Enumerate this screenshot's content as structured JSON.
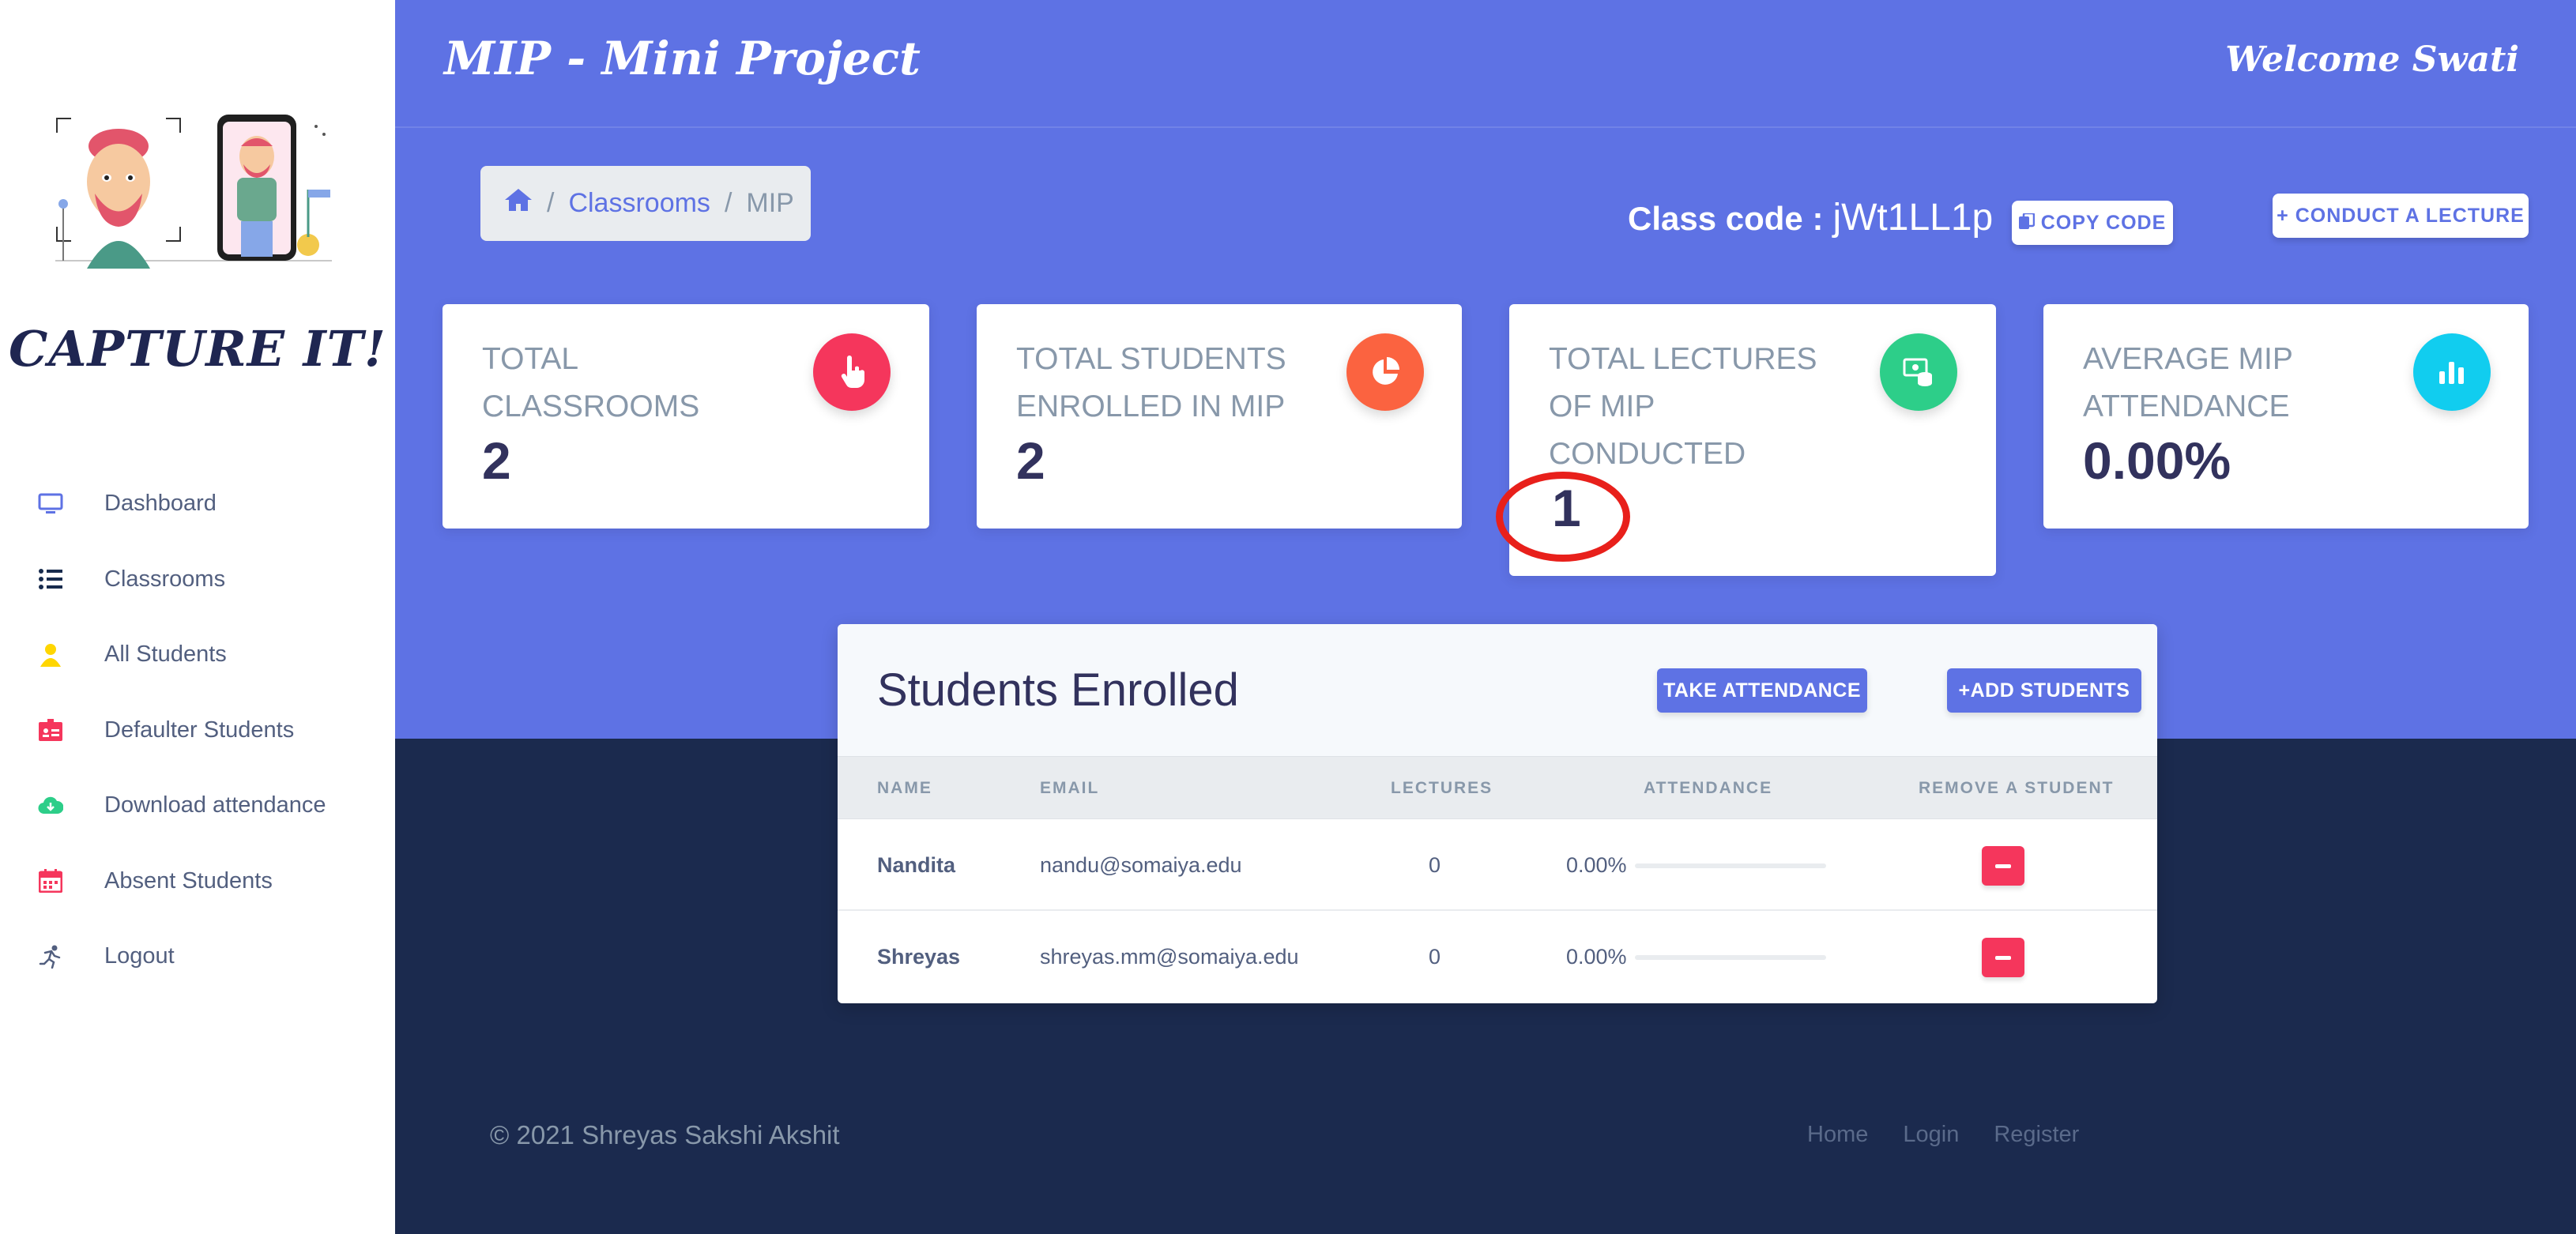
{
  "app": {
    "title": "MIP - Mini Project",
    "welcome": "Welcome Swati"
  },
  "brand": {
    "name": "CAPTURE IT!"
  },
  "sidebar": {
    "items": [
      {
        "label": "Dashboard",
        "icon": "monitor-icon",
        "color": "#5e72e4"
      },
      {
        "label": "Classrooms",
        "icon": "list-icon",
        "color": "#172b4d"
      },
      {
        "label": "All Students",
        "icon": "user-icon",
        "color": "#ffd600"
      },
      {
        "label": "Defaulter Students",
        "icon": "id-card-icon",
        "color": "#f5365c"
      },
      {
        "label": "Download attendance",
        "icon": "cloud-download-icon",
        "color": "#2dce89"
      },
      {
        "label": "Absent Students",
        "icon": "calendar-icon",
        "color": "#f5365c"
      },
      {
        "label": "Logout",
        "icon": "running-icon",
        "color": "#525f7f"
      }
    ]
  },
  "breadcrumb": {
    "link": "Classrooms",
    "current": "MIP",
    "sep": "/"
  },
  "classcode": {
    "label": "Class code :",
    "value": "jWt1LL1p",
    "copy_label": "COPY CODE",
    "conduct_label": "+ CONDUCT A LECTURE"
  },
  "stats": [
    {
      "title": "TOTAL CLASSROOMS",
      "value": "2",
      "icon": "hand-pointer-icon",
      "color": "#f5365c"
    },
    {
      "title": "TOTAL STUDENTS ENROLLED IN MIP",
      "value": "2",
      "icon": "pie-chart-icon",
      "color": "#fb6340"
    },
    {
      "title": "TOTAL LECTURES OF MIP CONDUCTED",
      "value": "1",
      "icon": "money-coins-icon",
      "color": "#2dce89"
    },
    {
      "title": "AVERAGE MIP ATTENDANCE",
      "value": "0.00%",
      "icon": "bar-chart-icon",
      "color": "#11cdef"
    }
  ],
  "students": {
    "title": "Students Enrolled",
    "take_label": "TAKE ATTENDANCE",
    "add_label": "+ADD STUDENTS",
    "columns": [
      "NAME",
      "EMAIL",
      "LECTURES",
      "ATTENDANCE",
      "REMOVE A STUDENT"
    ],
    "rows": [
      {
        "name": "Nandita",
        "email": "nandu@somaiya.edu",
        "lectures": "0",
        "attendance": "0.00%",
        "attendance_fraction": 0
      },
      {
        "name": "Shreyas",
        "email": "shreyas.mm@somaiya.edu",
        "lectures": "0",
        "attendance": "0.00%",
        "attendance_fraction": 0
      }
    ]
  },
  "footer": {
    "copyright": "© 2021 Shreyas Sakshi Akshit",
    "links": [
      "Home",
      "Login",
      "Register"
    ]
  },
  "colors": {
    "primary": "#5e72e4",
    "dark": "#1b2a4e",
    "danger": "#f5365c",
    "highlight": "#e8201b"
  }
}
